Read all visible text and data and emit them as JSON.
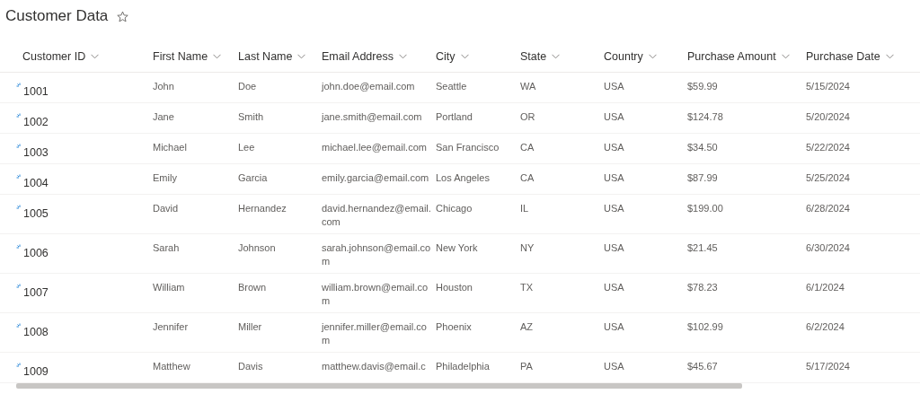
{
  "page": {
    "title": "Customer Data",
    "favorite": false
  },
  "table": {
    "columns": [
      "Customer ID",
      "First Name",
      "Last Name",
      "Email Address",
      "City",
      "State",
      "Country",
      "Purchase Amount",
      "Purchase Date"
    ],
    "rows": [
      {
        "new": true,
        "cells": [
          "1001",
          "John",
          "Doe",
          "john.doe@email.com",
          "Seattle",
          "WA",
          "USA",
          "$59.99",
          "5/15/2024"
        ]
      },
      {
        "new": true,
        "cells": [
          "1002",
          "Jane",
          "Smith",
          "jane.smith@email.com",
          "Portland",
          "OR",
          "USA",
          "$124.78",
          "5/20/2024"
        ]
      },
      {
        "new": true,
        "cells": [
          "1003",
          "Michael",
          "Lee",
          "michael.lee@email.com",
          "San Francisco",
          "CA",
          "USA",
          "$34.50",
          "5/22/2024"
        ]
      },
      {
        "new": true,
        "cells": [
          "1004",
          "Emily",
          "Garcia",
          "emily.garcia@email.com",
          "Los Angeles",
          "CA",
          "USA",
          "$87.99",
          "5/25/2024"
        ]
      },
      {
        "new": true,
        "cells": [
          "1005",
          "David",
          "Hernandez",
          "david.hernandez@email.com",
          "Chicago",
          "IL",
          "USA",
          "$199.00",
          "6/28/2024"
        ]
      },
      {
        "new": true,
        "cells": [
          "1006",
          "Sarah",
          "Johnson",
          "sarah.johnson@email.com",
          "New York",
          "NY",
          "USA",
          "$21.45",
          "6/30/2024"
        ]
      },
      {
        "new": true,
        "cells": [
          "1007",
          "William",
          "Brown",
          "william.brown@email.com",
          "Houston",
          "TX",
          "USA",
          "$78.23",
          "6/1/2024"
        ]
      },
      {
        "new": true,
        "cells": [
          "1008",
          "Jennifer",
          "Miller",
          "jennifer.miller@email.com",
          "Phoenix",
          "AZ",
          "USA",
          "$102.99",
          "6/2/2024"
        ]
      },
      {
        "new": true,
        "cells": [
          "1009",
          "Matthew",
          "Davis",
          "matthew.davis@email.c",
          "Philadelphia",
          "PA",
          "USA",
          "$45.67",
          "5/17/2024"
        ]
      }
    ]
  }
}
